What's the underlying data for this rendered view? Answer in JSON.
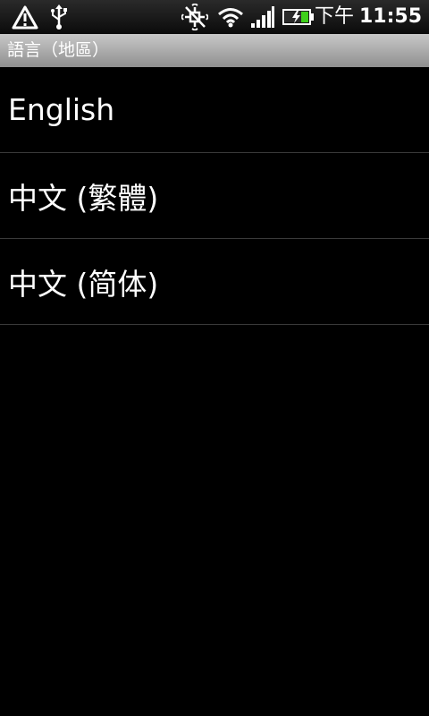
{
  "status_bar": {
    "icons": [
      "warning-icon",
      "usb-icon",
      "sync-off-icon",
      "wifi-icon",
      "signal-icon",
      "battery-charging-icon"
    ],
    "time_ampm": "下午",
    "time": "11:55",
    "battery_color": "#3fd11b"
  },
  "title_bar": {
    "title": "語言（地區）"
  },
  "languages": [
    {
      "label": "English"
    },
    {
      "label": "中文 (繁體)"
    },
    {
      "label": "中文 (简体)"
    }
  ]
}
